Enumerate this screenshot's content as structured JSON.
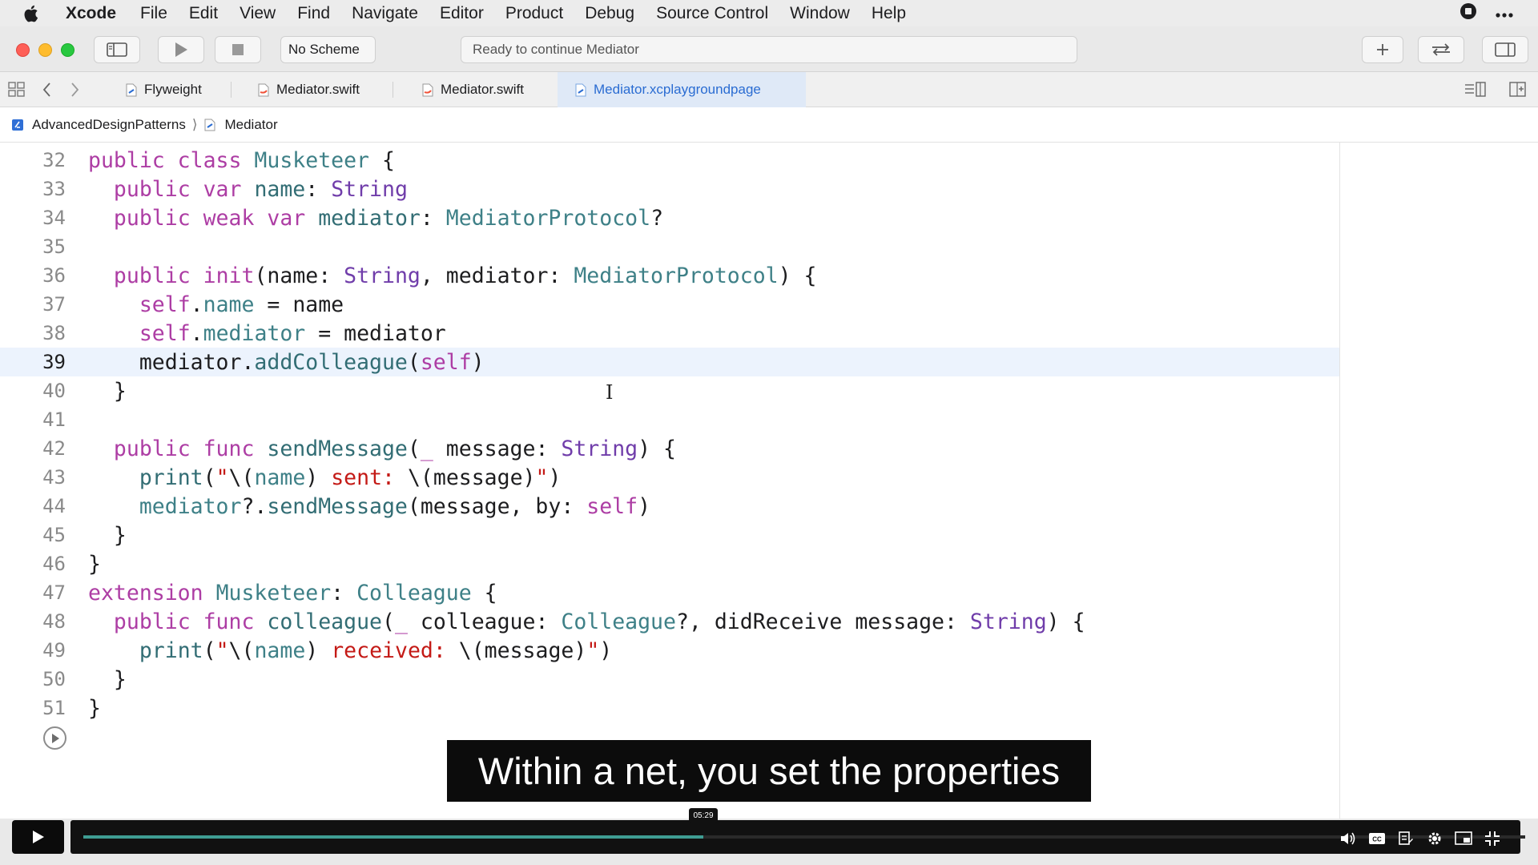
{
  "menubar": {
    "app_name": "Xcode",
    "items": [
      "File",
      "Edit",
      "View",
      "Find",
      "Navigate",
      "Editor",
      "Product",
      "Debug",
      "Source Control",
      "Window",
      "Help"
    ]
  },
  "toolbar": {
    "scheme_label": "No Scheme",
    "activity_status": "Ready to continue Mediator"
  },
  "tabs": [
    {
      "label": "Flyweight",
      "active": false
    },
    {
      "label": "Mediator.swift",
      "active": false
    },
    {
      "label": "Mediator.swift",
      "active": false
    },
    {
      "label": "Mediator.xcplaygroundpage",
      "active": true
    }
  ],
  "breadcrumb": {
    "project": "AdvancedDesignPatterns",
    "page": "Mediator"
  },
  "editor": {
    "current_line": 39,
    "line_numbers": [
      "32",
      "33",
      "34",
      "35",
      "36",
      "37",
      "38",
      "39",
      "40",
      "41",
      "42",
      "43",
      "44",
      "45",
      "46",
      "47",
      "48",
      "49",
      "50",
      "51"
    ]
  },
  "caption": "Within a net, you set the properties",
  "player": {
    "current_time": "05:29",
    "progress": 0.43
  },
  "colors": {
    "keyword": "#ad3da4",
    "type": "#3e8087",
    "string": "#c41a16",
    "active_tab": "#2a6cd2",
    "progress": "#3f9d93"
  }
}
